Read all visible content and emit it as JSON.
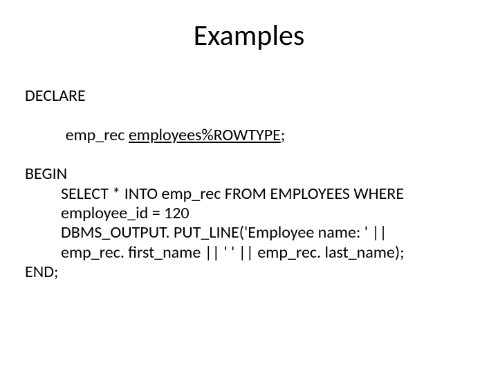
{
  "title": "Examples",
  "code": {
    "l1": "DECLARE",
    "l2a": "emp_rec",
    "l2b": " ",
    "l2c": "employees%ROWTYPE",
    "l2d": ";",
    "l3": "BEGIN",
    "l4": "SELECT * INTO emp_rec FROM EMPLOYEES WHERE",
    "l5": "employee_id = 120",
    "l6": "DBMS_OUTPUT. PUT_LINE('Employee name: ' ||",
    "l7": "emp_rec. first_name || ' ' || emp_rec. last_name);",
    "l8": "END;"
  }
}
